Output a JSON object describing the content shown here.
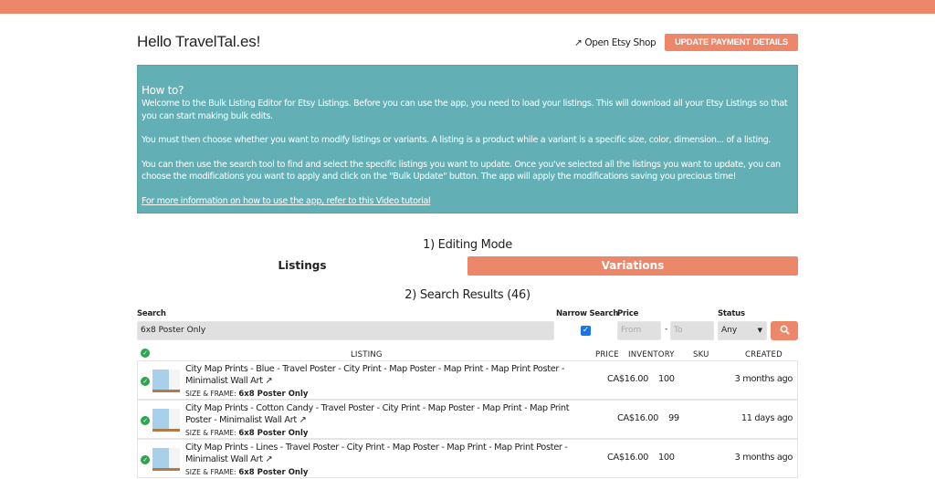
{
  "header": {
    "greeting": "Hello TravelTal.es!",
    "open_shop": "Open Etsy Shop",
    "update_payment": "UPDATE PAYMENT DETAILS"
  },
  "info": {
    "title": "How to?",
    "p1": "Welcome to the Bulk Listing Editor for Etsy Listings. Before you can use the app, you need to load your listings. This will download all your Etsy Listings so that you can start making bulk edits.",
    "p2": "You must then choose whether you want to modify listings or variants. A listing is a product while a variant is a specific size, color, dimension... of a listing.",
    "p3": "You can then use the search tool to find and select the specific listings you want to update. Once you've selected all the listings you want to update, you can choose the modifications you want to apply and click on the \"Bulk Update\" button. The app will apply the modifications saving you precious time!",
    "link": "For more information on how to use the app, refer to this Video tutorial"
  },
  "mode": {
    "title": "1) Editing Mode",
    "tab_listings": "Listings",
    "tab_variations": "Variations"
  },
  "search": {
    "title": "2) Search Results (46)",
    "search_label": "Search",
    "search_value": "6x8 Poster Only",
    "narrow_label": "Narrow Search",
    "narrow_checked": true,
    "price_label": "Price",
    "from_placeholder": "From",
    "to_placeholder": "To",
    "dash": "-",
    "status_label": "Status",
    "status_value": "Any"
  },
  "table": {
    "headers": {
      "listing": "LISTING",
      "price": "PRICE",
      "inventory": "INVENTORY",
      "sku": "SKU",
      "created": "CREATED"
    },
    "rows": [
      {
        "title": "City Map Prints - Blue - Travel Poster - City Print - Map Poster - Map Print - Map Print Poster - Minimalist Wall Art",
        "option_label": "SIZE & FRAME:",
        "option_value": "6x8 Poster Only",
        "price": "CA$16.00",
        "inventory": "100",
        "sku": "",
        "created": "3 months ago"
      },
      {
        "title": "City Map Prints - Cotton Candy - Travel Poster - City Print - Map Poster - Map Print - Map Print Poster - Minimalist Wall Art",
        "option_label": "SIZE & FRAME:",
        "option_value": "6x8 Poster Only",
        "price": "CA$16.00",
        "inventory": "99",
        "sku": "",
        "created": "11 days ago"
      },
      {
        "title": "City Map Prints - Lines - Travel Poster - City Print - Map Poster - Map Print - Map Print Poster - Minimalist Wall Art",
        "option_label": "SIZE & FRAME:",
        "option_value": "6x8 Poster Only",
        "price": "CA$16.00",
        "inventory": "100",
        "sku": "",
        "created": "3 months ago"
      }
    ]
  },
  "colors": {
    "accent": "#ec8769",
    "info_bg": "#62b0b5",
    "check": "#2ea44f"
  }
}
